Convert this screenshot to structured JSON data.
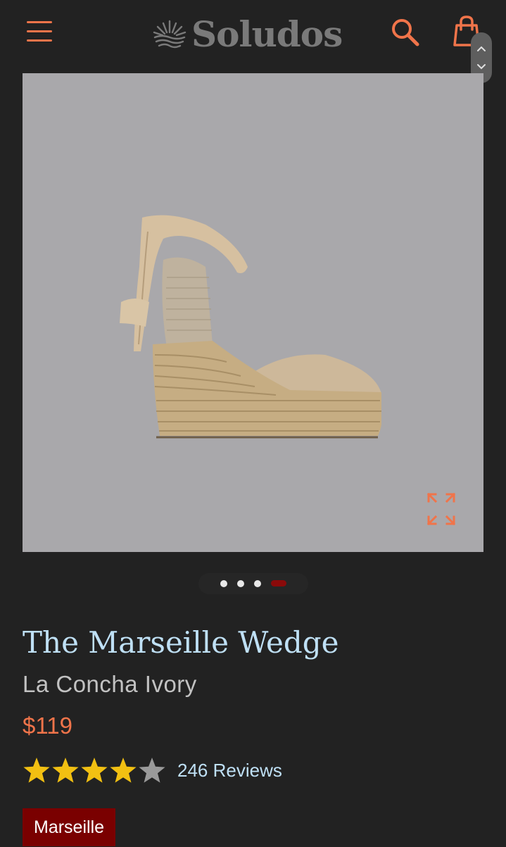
{
  "header": {
    "brand": "Soludos",
    "icons": {
      "menu": "hamburger-menu-icon",
      "search": "search-icon",
      "cart": "shopping-bag-icon",
      "logo": "sun-wave-logo-icon"
    }
  },
  "scroll_control": {
    "up": "chevron-up-icon",
    "down": "chevron-down-icon"
  },
  "gallery": {
    "slide_count": 4,
    "active_slide": 4,
    "expand_icon": "expand-arrows-icon"
  },
  "product": {
    "title": "The Marseille Wedge",
    "color_name": "La Concha Ivory",
    "price": "$119",
    "rating": 4.5,
    "reviews_label": "246 Reviews",
    "variant": "Marseille"
  },
  "colors": {
    "accent": "#f0744a",
    "title": "#bfe0f5",
    "background": "#222222",
    "variant_bg": "#7a0000",
    "star": "#f2c012"
  }
}
